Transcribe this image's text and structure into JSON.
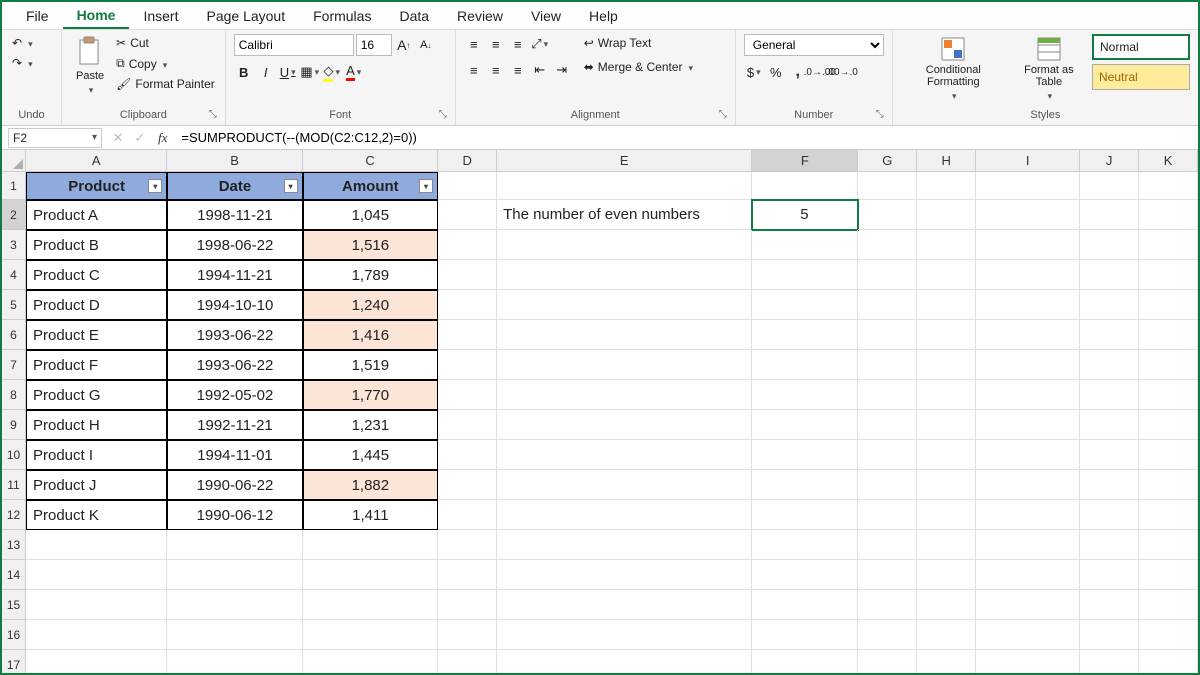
{
  "menu": [
    "File",
    "Home",
    "Insert",
    "Page Layout",
    "Formulas",
    "Data",
    "Review",
    "View",
    "Help"
  ],
  "active_menu": "Home",
  "ribbon": {
    "undo_label": "Undo",
    "clipboard": {
      "paste": "Paste",
      "cut": "Cut",
      "copy": "Copy",
      "format_painter": "Format Painter",
      "label": "Clipboard"
    },
    "font": {
      "name": "Calibri",
      "size": "16",
      "label": "Font"
    },
    "alignment": {
      "wrap": "Wrap Text",
      "merge": "Merge & Center",
      "label": "Alignment"
    },
    "number": {
      "format": "General",
      "label": "Number"
    },
    "styles": {
      "cond": "Conditional Formatting",
      "fmt_table": "Format as Table",
      "normal": "Normal",
      "neutral": "Neutral",
      "label": "Styles"
    }
  },
  "name_box": "F2",
  "formula": "=SUMPRODUCT(--(MOD(C2:C12,2)=0))",
  "cols": [
    "A",
    "B",
    "C",
    "D",
    "E",
    "F",
    "G",
    "H",
    "I",
    "J",
    "K"
  ],
  "headers": {
    "A": "Product",
    "B": "Date",
    "C": "Amount"
  },
  "rows": [
    {
      "n": 1
    },
    {
      "n": 2,
      "A": "Product A",
      "B": "1998-11-21",
      "C": "1,045",
      "hl": false
    },
    {
      "n": 3,
      "A": "Product B",
      "B": "1998-06-22",
      "C": "1,516",
      "hl": true
    },
    {
      "n": 4,
      "A": "Product C",
      "B": "1994-11-21",
      "C": "1,789",
      "hl": false
    },
    {
      "n": 5,
      "A": "Product D",
      "B": "1994-10-10",
      "C": "1,240",
      "hl": true
    },
    {
      "n": 6,
      "A": "Product E",
      "B": "1993-06-22",
      "C": "1,416",
      "hl": true
    },
    {
      "n": 7,
      "A": "Product F",
      "B": "1993-06-22",
      "C": "1,519",
      "hl": false
    },
    {
      "n": 8,
      "A": "Product G",
      "B": "1992-05-02",
      "C": "1,770",
      "hl": true
    },
    {
      "n": 9,
      "A": "Product H",
      "B": "1992-11-21",
      "C": "1,231",
      "hl": false
    },
    {
      "n": 10,
      "A": "Product I",
      "B": "1994-11-01",
      "C": "1,445",
      "hl": false
    },
    {
      "n": 11,
      "A": "Product J",
      "B": "1990-06-22",
      "C": "1,882",
      "hl": true
    },
    {
      "n": 12,
      "A": "Product K",
      "B": "1990-06-12",
      "C": "1,411",
      "hl": false
    },
    {
      "n": 13
    },
    {
      "n": 14
    },
    {
      "n": 15
    },
    {
      "n": 16
    },
    {
      "n": 17
    }
  ],
  "side": {
    "E2": "The number of even numbers",
    "F2": "5"
  },
  "active_cell": "F2"
}
